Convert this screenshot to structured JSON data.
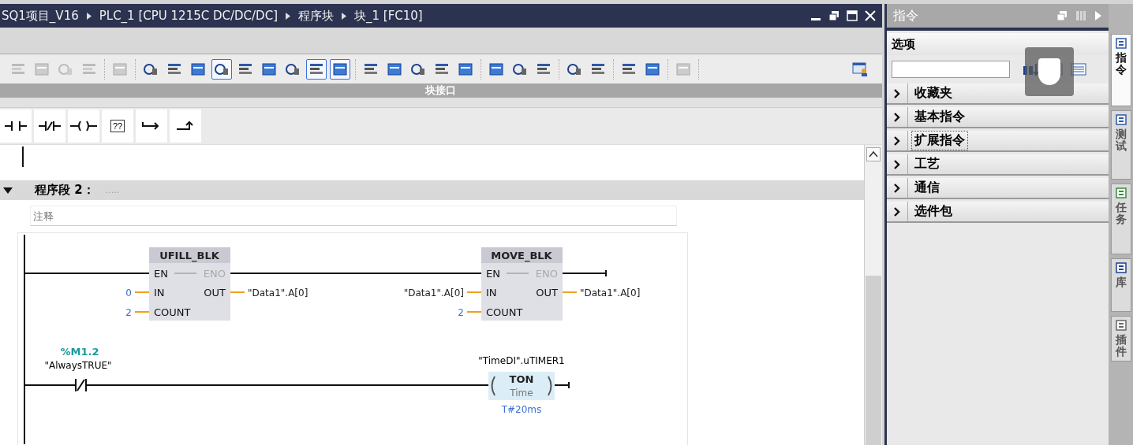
{
  "editor": {
    "breadcrumb": [
      "SQ1项目_V16",
      "PLC_1 [CPU 1215C DC/DC/DC]",
      "程序块",
      "块_1 [FC10]"
    ],
    "toolbar": {
      "groups": [
        [
          {
            "disabled": true,
            "pressed": false
          },
          {
            "disabled": true,
            "pressed": false
          },
          {
            "disabled": true,
            "pressed": false
          },
          {
            "disabled": true,
            "pressed": false
          }
        ],
        [
          {
            "disabled": true,
            "pressed": false
          }
        ],
        [
          {
            "disabled": false,
            "pressed": false
          },
          {
            "disabled": false,
            "pressed": false
          },
          {
            "disabled": false,
            "pressed": false
          },
          {
            "disabled": false,
            "pressed": true
          },
          {
            "disabled": false,
            "pressed": false
          },
          {
            "disabled": false,
            "pressed": false
          },
          {
            "disabled": false,
            "pressed": false
          },
          {
            "disabled": false,
            "pressed": true
          },
          {
            "disabled": false,
            "pressed": true
          }
        ],
        [
          {
            "disabled": false,
            "pressed": false
          },
          {
            "disabled": false,
            "pressed": false
          },
          {
            "disabled": false,
            "pressed": false
          },
          {
            "disabled": false,
            "pressed": false
          },
          {
            "disabled": false,
            "pressed": false
          }
        ],
        [
          {
            "disabled": false,
            "pressed": false
          },
          {
            "disabled": false,
            "pressed": false
          },
          {
            "disabled": false,
            "pressed": false
          }
        ],
        [
          {
            "disabled": false,
            "pressed": false
          },
          {
            "disabled": false,
            "pressed": false
          }
        ],
        [
          {
            "disabled": false,
            "pressed": false
          },
          {
            "disabled": false,
            "pressed": false
          }
        ],
        [
          {
            "disabled": true,
            "pressed": false
          }
        ]
      ]
    },
    "interface_bar": {
      "label": "块接口"
    },
    "palette": [
      {
        "kind": "no_contact"
      },
      {
        "kind": "nc_contact"
      },
      {
        "kind": "coil"
      },
      {
        "kind": "empty_box",
        "label": "??"
      },
      {
        "kind": "open_branch"
      },
      {
        "kind": "close_branch"
      }
    ],
    "network": {
      "title": "程序段 2：",
      "title_comment": ".....",
      "expanded": true,
      "comment": "注释",
      "boxes": [
        {
          "name": "UFILL_BLK",
          "en": "EN",
          "eno": "ENO",
          "inputs": [
            {
              "pin": "IN",
              "operand": "0",
              "kind": "constant"
            },
            {
              "pin": "COUNT",
              "operand": "2",
              "kind": "constant"
            }
          ],
          "output": {
            "pin": "OUT",
            "operand": "\"Data1\".A[0]",
            "kind": "tag"
          }
        },
        {
          "name": "MOVE_BLK",
          "en": "EN",
          "eno": "ENO",
          "inputs": [
            {
              "pin": "IN",
              "operand": "\"Data1\".A[0]",
              "kind": "tag"
            },
            {
              "pin": "COUNT",
              "operand": "2",
              "kind": "constant"
            }
          ],
          "output": {
            "pin": "OUT",
            "operand": "\"Data1\".A[0]",
            "kind": "tag"
          }
        }
      ],
      "contact": {
        "kind": "nc",
        "address": "%M1.2",
        "tag": "\"AlwaysTRUE\""
      },
      "coil": {
        "instance": "\"TimeDI\".uTIMER1",
        "type": "TON",
        "param": "Time",
        "preset": "T#20ms"
      }
    }
  },
  "instructions": {
    "title": "指令",
    "options": "选项",
    "folders": [
      {
        "label": "收藏夹",
        "expanded": false,
        "focused": false
      },
      {
        "label": "基本指令",
        "expanded": false,
        "focused": false
      },
      {
        "label": "扩展指令",
        "expanded": false,
        "focused": true
      },
      {
        "label": "工艺",
        "expanded": false,
        "focused": false
      },
      {
        "label": "通信",
        "expanded": false,
        "focused": false
      },
      {
        "label": "选件包",
        "expanded": false,
        "focused": false
      }
    ]
  },
  "side_tabs": [
    {
      "label": "指令",
      "selected": true
    },
    {
      "label": "测试",
      "selected": false
    },
    {
      "label": "任务",
      "selected": false
    },
    {
      "label": "库",
      "selected": false
    },
    {
      "label": "插件",
      "selected": false
    }
  ]
}
